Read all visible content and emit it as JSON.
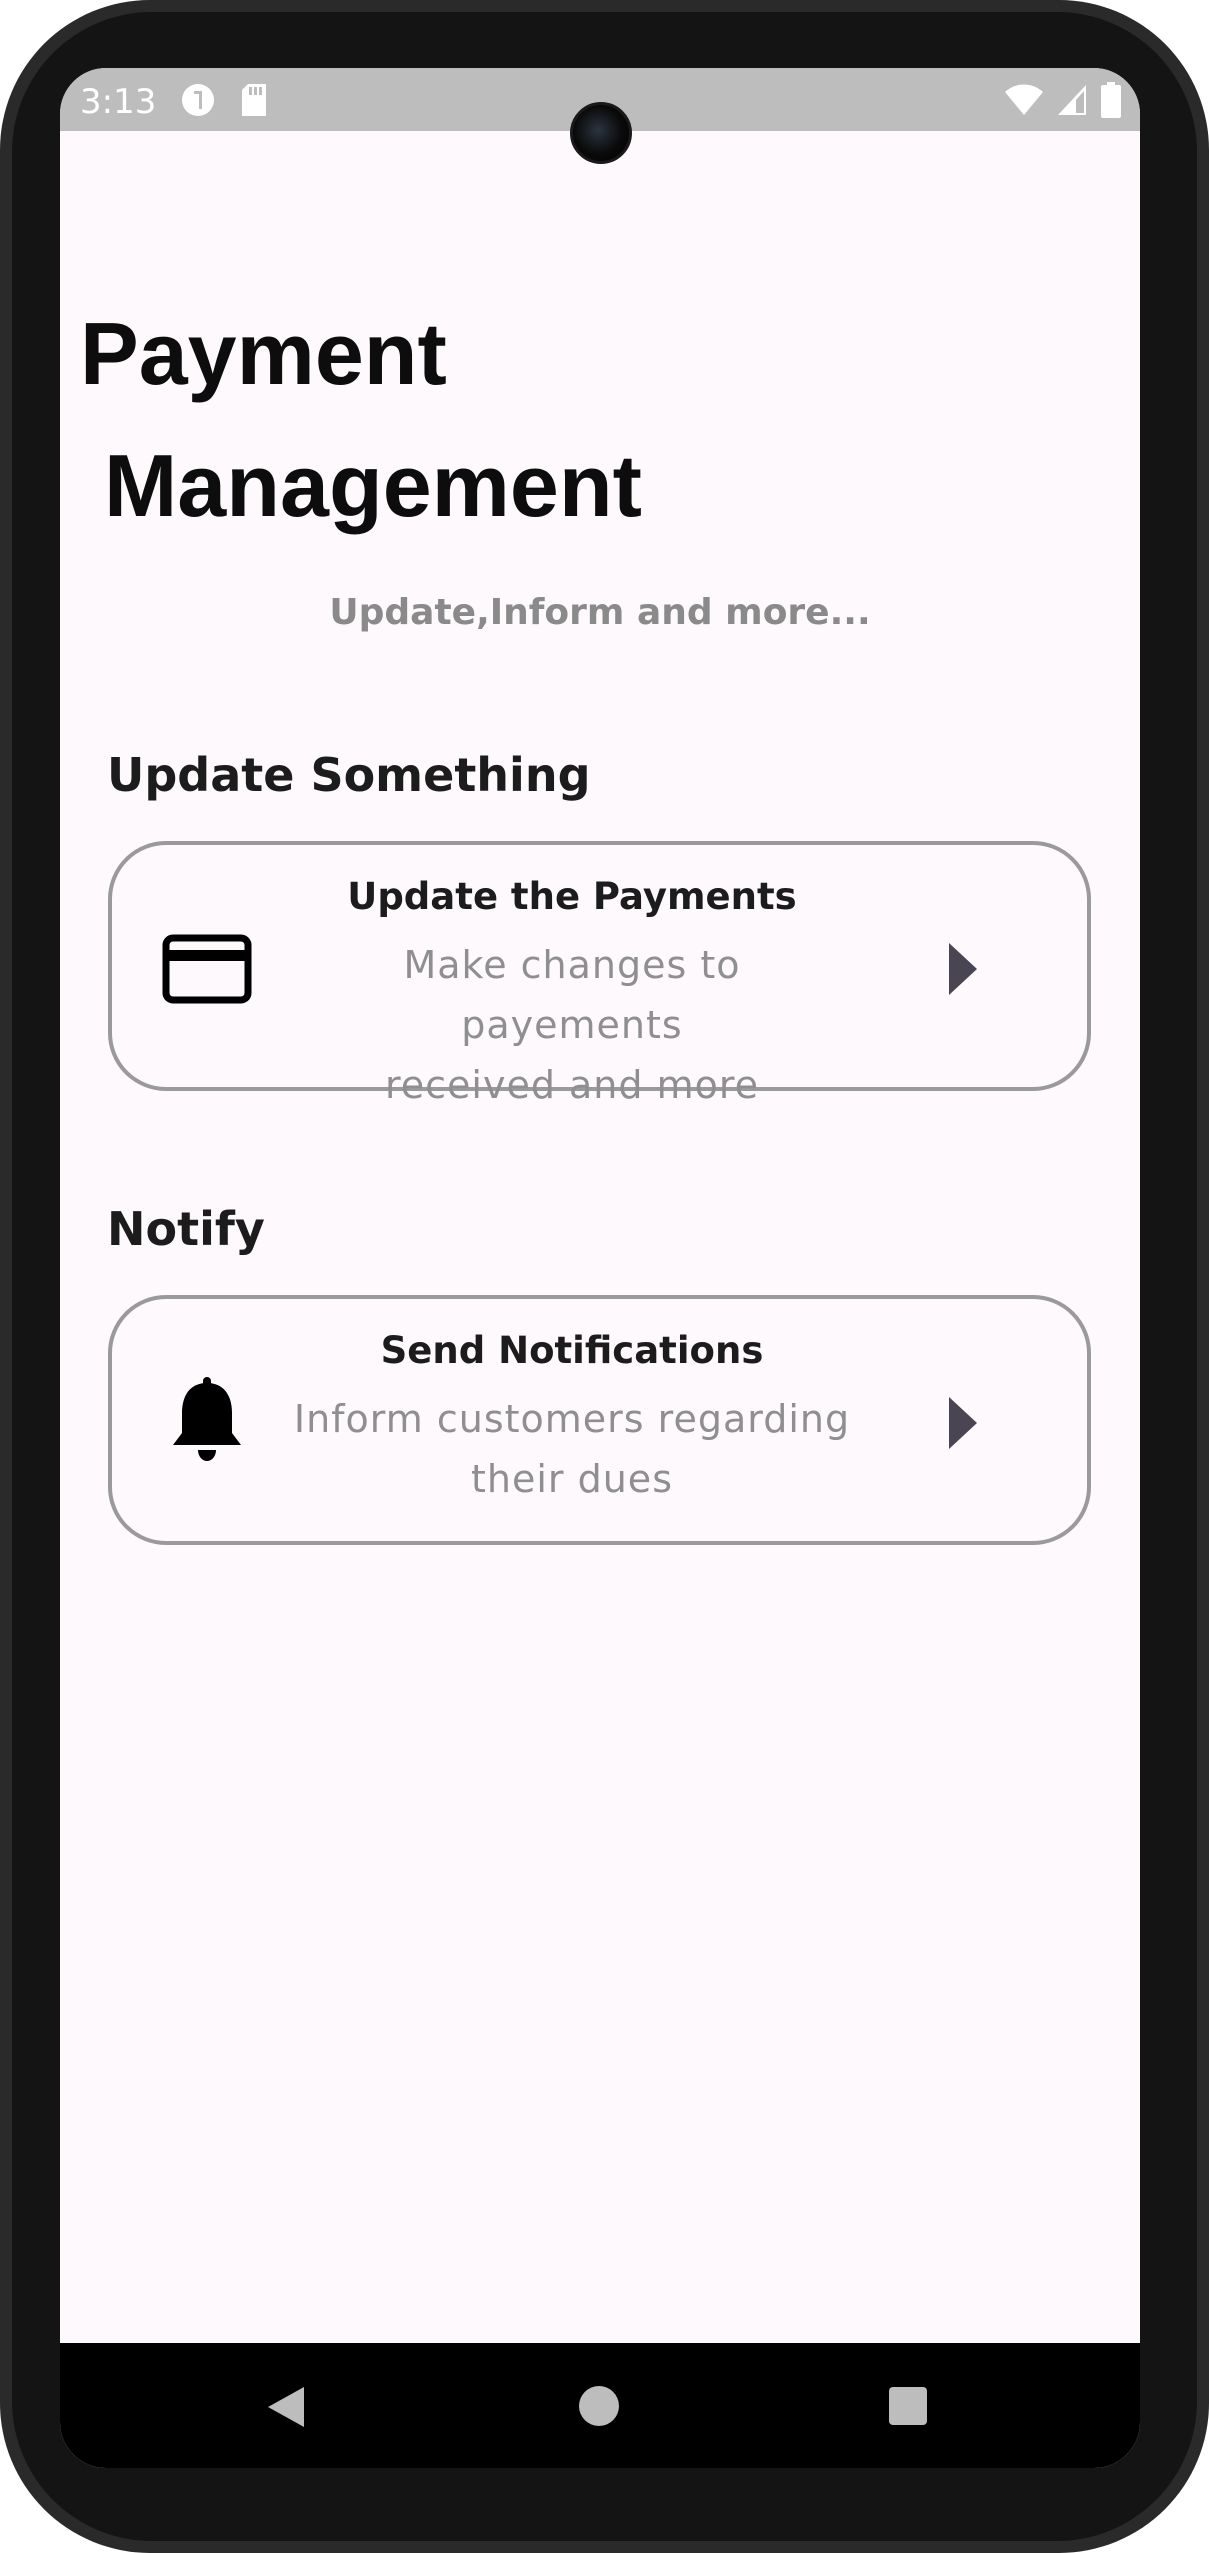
{
  "status_bar": {
    "time": "3:13",
    "left_icons": [
      "data-saver-icon",
      "sd-card-icon"
    ],
    "right_icons": [
      "wifi-icon",
      "cell-signal-icon",
      "battery-icon"
    ]
  },
  "header": {
    "title_line1": "Payment",
    "title_line2": "Management",
    "subtitle": "Update,Inform and more..."
  },
  "sections": [
    {
      "heading": "Update Something",
      "card": {
        "icon": "credit-card-icon",
        "title": "Update the Payments",
        "description_line1": "Make changes to payements",
        "description_line2": "received and more",
        "arrow_icon": "play-arrow-icon"
      }
    },
    {
      "heading": "Notify",
      "card": {
        "icon": "bell-icon",
        "title": "Send Notifications",
        "description_line1": "Inform customers regarding",
        "description_line2": "their dues",
        "arrow_icon": "play-arrow-icon"
      }
    }
  ],
  "nav_bar": {
    "buttons": [
      "back-icon",
      "home-icon",
      "recents-icon"
    ]
  },
  "colors": {
    "background": "#fdf9fc",
    "title": "#0d0d0d",
    "subtitle": "#8a8a8a",
    "card_border": "#9a9a9a",
    "arrow": "#4a4553",
    "status_bar": "#bdbdbd"
  }
}
